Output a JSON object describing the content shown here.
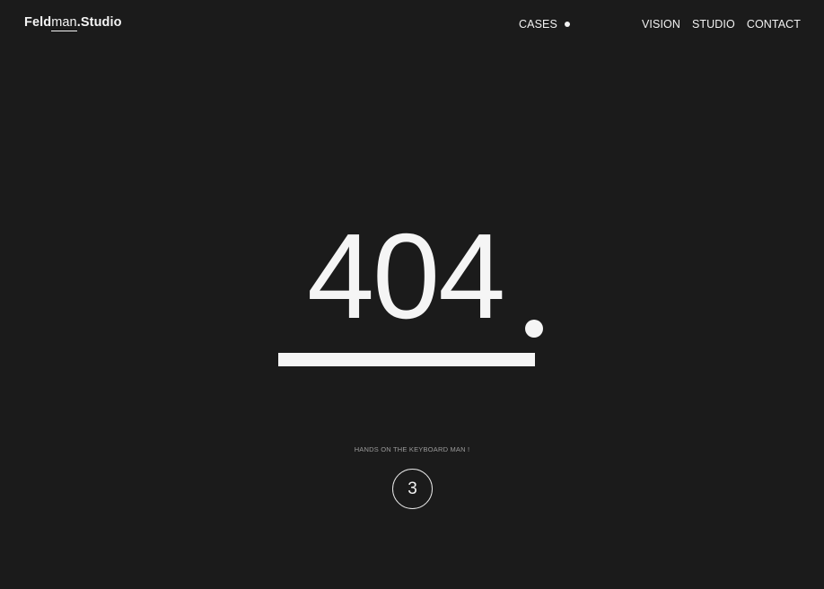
{
  "header": {
    "logo": {
      "part1": "Feld",
      "part2": "man",
      "part3": ".",
      "part4": "Studio"
    },
    "nav": {
      "cases": "CASES",
      "vision": "VISION",
      "studio": "STUDIO",
      "contact": "CONTACT"
    }
  },
  "main": {
    "error_code": "404",
    "caption": "HANDS ON THE KEYBOARD MAN !",
    "countdown": "3"
  },
  "colors": {
    "background": "#1b1b1b",
    "foreground": "#f5f5f5",
    "caption": "#9a9a9a"
  }
}
